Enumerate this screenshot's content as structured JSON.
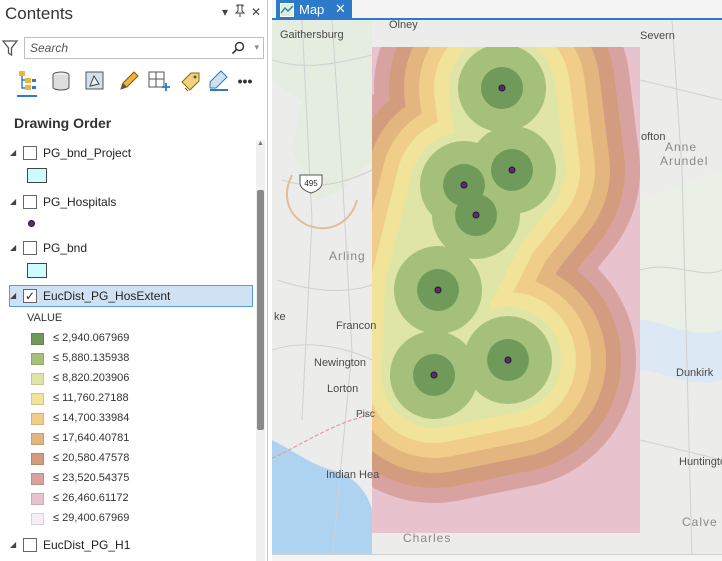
{
  "contents": {
    "title": "Contents",
    "search_placeholder": "Search",
    "drawing_order_heading": "Drawing Order",
    "toolbar": [
      "list-by-drawing-order-icon",
      "list-by-data-source-icon",
      "list-by-selection-icon",
      "list-by-editing-icon",
      "list-by-snapping-icon",
      "list-by-labeling-icon",
      "list-by-perspective-imagery-icon",
      "more-options-icon"
    ],
    "more_label": "•••"
  },
  "layers": [
    {
      "name": "PG_bnd_Project",
      "checked": false,
      "symbol": "polygon"
    },
    {
      "name": "PG_Hospitals",
      "checked": false,
      "symbol": "point"
    },
    {
      "name": "PG_bnd",
      "checked": false,
      "symbol": "polygon"
    },
    {
      "name": "EucDist_PG_HosExtent",
      "checked": true,
      "selected": true,
      "symbol": "raster"
    },
    {
      "name": "EucDist_PG_H1",
      "checked": false
    }
  ],
  "legend": {
    "field": "VALUE",
    "classes": [
      {
        "label": "≤ 2,940.067969",
        "color": "#6f9a5a"
      },
      {
        "label": "≤ 5,880.135938",
        "color": "#a4c07a"
      },
      {
        "label": "≤ 8,820.203906",
        "color": "#dfe5a6"
      },
      {
        "label": "≤ 11,760.27188",
        "color": "#f1e39a"
      },
      {
        "label": "≤ 14,700.33984",
        "color": "#f0cd88"
      },
      {
        "label": "≤ 17,640.40781",
        "color": "#e3b67f"
      },
      {
        "label": "≤ 20,580.47578",
        "color": "#d39c7f"
      },
      {
        "label": "≤ 23,520.54375",
        "color": "#d8a2a1"
      },
      {
        "label": "≤ 26,460.61172",
        "color": "#e8c3cd"
      },
      {
        "label": "≤ 29,400.67969",
        "color": "#f7eef3"
      }
    ]
  },
  "map": {
    "tab_label": "Map",
    "close_glyph": "✕",
    "place_labels": [
      "Olney",
      "Gaithersburg",
      "Severn",
      "Anne",
      "Arundel",
      "ofton",
      "Arling",
      "ke",
      "Francon",
      "Newington",
      "Lorton",
      "Dunkirk",
      "Pisc",
      "Indian Hea",
      "Huntingto",
      "Charles",
      "Calve"
    ],
    "hospitals": 7,
    "road_shield": "495"
  },
  "pane_controls": {
    "dropdown": "▾",
    "pin": "⊥",
    "close": "✕"
  }
}
